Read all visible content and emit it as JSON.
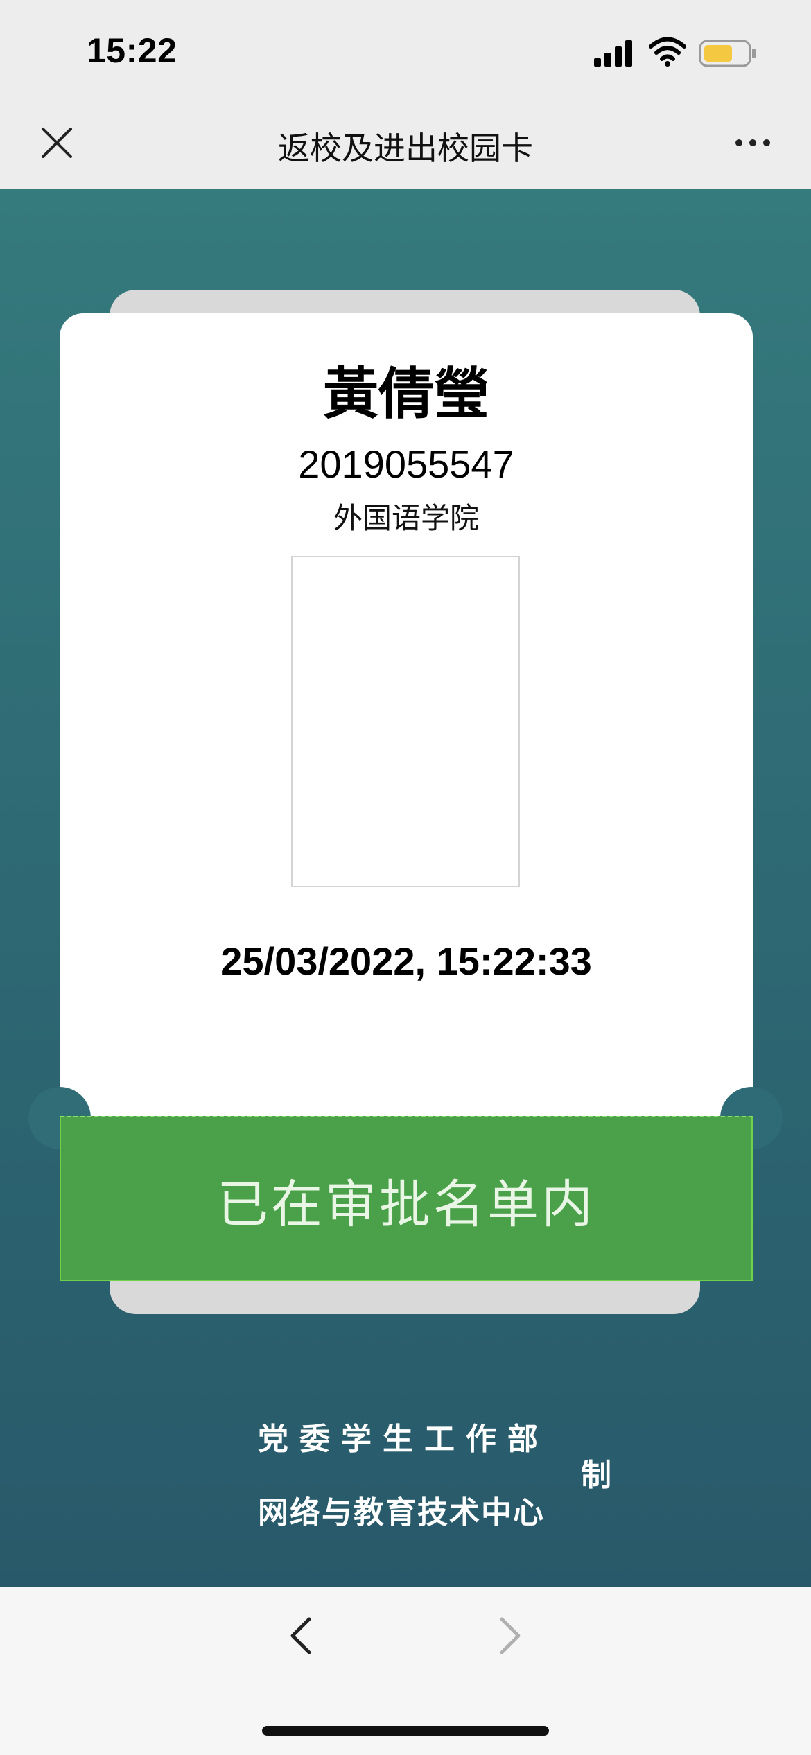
{
  "status_bar": {
    "time": "15:22",
    "icons": [
      "signal-icon",
      "wifi-icon",
      "battery-icon"
    ],
    "battery_color": "#f5c842"
  },
  "nav": {
    "title": "返校及进出校园卡",
    "left_icon": "close-icon",
    "right_icon": "more-icon"
  },
  "card": {
    "name": "黃倩瑩",
    "student_id": "2019055547",
    "college": "外国语学院",
    "timestamp": "25/03/2022, 15:22:33",
    "status": "已在审批名单内",
    "status_color": "#4aa149"
  },
  "footer": {
    "line1": "党委学生工作部",
    "line2": "网络与教育技术中心",
    "suffix": "制"
  },
  "toolbar": {
    "back_icon": "chevron-left-icon",
    "forward_icon": "chevron-right-icon"
  },
  "theme": {
    "background_teal": "#2f6c75",
    "nav_background": "#ededed"
  }
}
